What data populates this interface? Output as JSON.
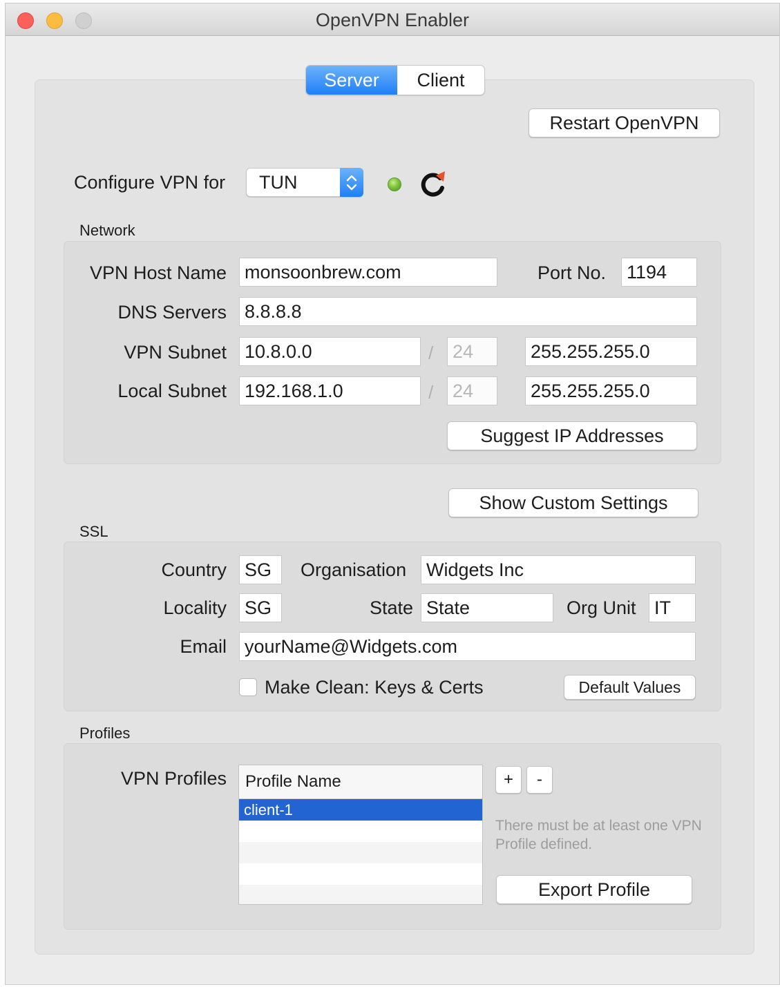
{
  "window": {
    "title": "OpenVPN Enabler"
  },
  "tabs": {
    "server": "Server",
    "client": "Client",
    "selected": "Server"
  },
  "toolbar": {
    "restart_label": "Restart OpenVPN"
  },
  "configure": {
    "label": "Configure VPN for",
    "mode": "TUN",
    "status_color": "#7cc43a"
  },
  "network": {
    "title": "Network",
    "host_label": "VPN Host Name",
    "host_value": "monsoonbrew.com",
    "port_label": "Port No.",
    "port_value": "1194",
    "dns_label": "DNS Servers",
    "dns_value": "8.8.8.8",
    "vpn_subnet_label": "VPN Subnet",
    "vpn_subnet_value": "10.8.0.0",
    "vpn_subnet_bits": "24",
    "vpn_subnet_mask": "255.255.255.0",
    "local_subnet_label": "Local Subnet",
    "local_subnet_value": "192.168.1.0",
    "local_subnet_bits": "24",
    "local_subnet_mask": "255.255.255.0",
    "separator": "/",
    "suggest_label": "Suggest IP Addresses"
  },
  "custom": {
    "show_label": "Show Custom Settings"
  },
  "ssl": {
    "title": "SSL",
    "country_label": "Country",
    "country_value": "SG",
    "org_label": "Organisation",
    "org_value": "Widgets Inc",
    "locality_label": "Locality",
    "locality_value": "SG",
    "state_label": "State",
    "state_value": "State",
    "orgunit_label": "Org Unit",
    "orgunit_value": "IT",
    "email_label": "Email",
    "email_value": "yourName@Widgets.com",
    "clean_label": "Make Clean: Keys & Certs",
    "clean_checked": false,
    "defaults_label": "Default Values"
  },
  "profiles": {
    "title": "Profiles",
    "list_label": "VPN Profiles",
    "column_header": "Profile Name",
    "rows": [
      "client-1"
    ],
    "selected": "client-1",
    "add_label": "+",
    "remove_label": "-",
    "hint": "There must be at least one VPN Profile defined.",
    "export_label": "Export Profile"
  },
  "colors": {
    "accent": "#1f7ff7",
    "selection": "#2264d1"
  }
}
